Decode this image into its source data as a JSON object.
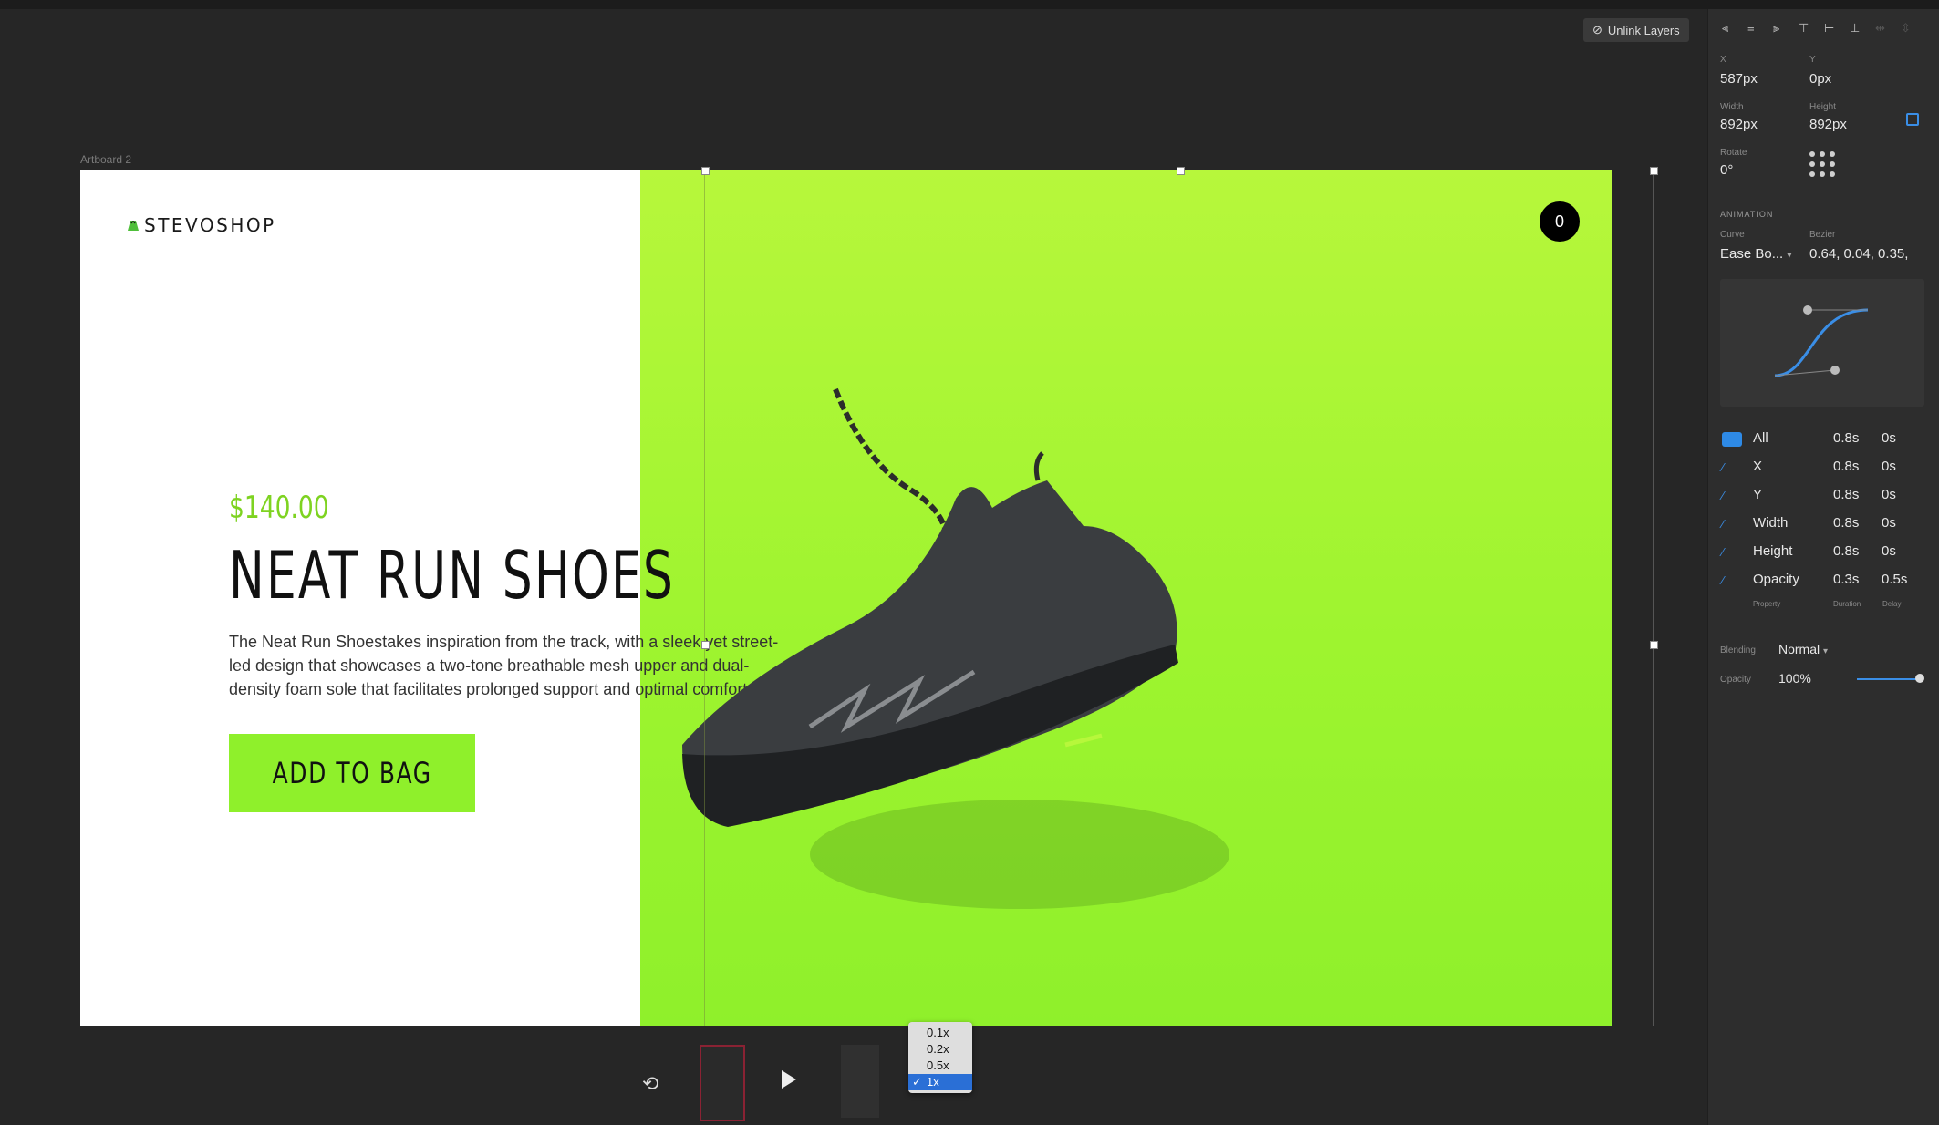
{
  "canvas": {
    "artboard_label": "Artboard 2"
  },
  "page": {
    "logo_text": "STEVOSHOP",
    "cart_count": "0",
    "price": "$140.00",
    "title": "NEAT RUN SHOES",
    "description": "The Neat Run Shoestakes inspiration from the track, with a sleek yet street-led design that showcases a two-tone breathable mesh upper and dual-density foam sole that facilitates prolonged support and optimal comfort.",
    "cta_label": "ADD TO BAG",
    "accent_color": "#8ff02b",
    "price_color": "#7ed321"
  },
  "toolbar": {
    "unlink_label": "Unlink Layers"
  },
  "inspector": {
    "x_label": "X",
    "x_value": "587px",
    "y_label": "Y",
    "y_value": "0px",
    "width_label": "Width",
    "width_value": "892px",
    "height_label": "Height",
    "height_value": "892px",
    "rotate_label": "Rotate",
    "rotate_value": "0°",
    "animation_title": "ANIMATION",
    "curve_label": "Curve",
    "curve_value": "Ease Bo...",
    "bezier_label": "Bezier",
    "bezier_value": "0.64, 0.04, 0.35,",
    "properties": [
      {
        "name": "All",
        "duration": "0.8s",
        "delay": "0s",
        "checked": true
      },
      {
        "name": "X",
        "duration": "0.8s",
        "delay": "0s",
        "checked": false
      },
      {
        "name": "Y",
        "duration": "0.8s",
        "delay": "0s",
        "checked": false
      },
      {
        "name": "Width",
        "duration": "0.8s",
        "delay": "0s",
        "checked": false
      },
      {
        "name": "Height",
        "duration": "0.8s",
        "delay": "0s",
        "checked": false
      },
      {
        "name": "Opacity",
        "duration": "0.3s",
        "delay": "0.5s",
        "checked": false
      }
    ],
    "col_property": "Property",
    "col_duration": "Duration",
    "col_delay": "Delay",
    "blending_label": "Blending",
    "blending_value": "Normal",
    "opacity_label": "Opacity",
    "opacity_value": "100%",
    "opacity_level": 1.0
  },
  "playback": {
    "speed_options": [
      "0.1x",
      "0.2x",
      "0.5x",
      "1x"
    ],
    "speed_selected": "1x"
  }
}
